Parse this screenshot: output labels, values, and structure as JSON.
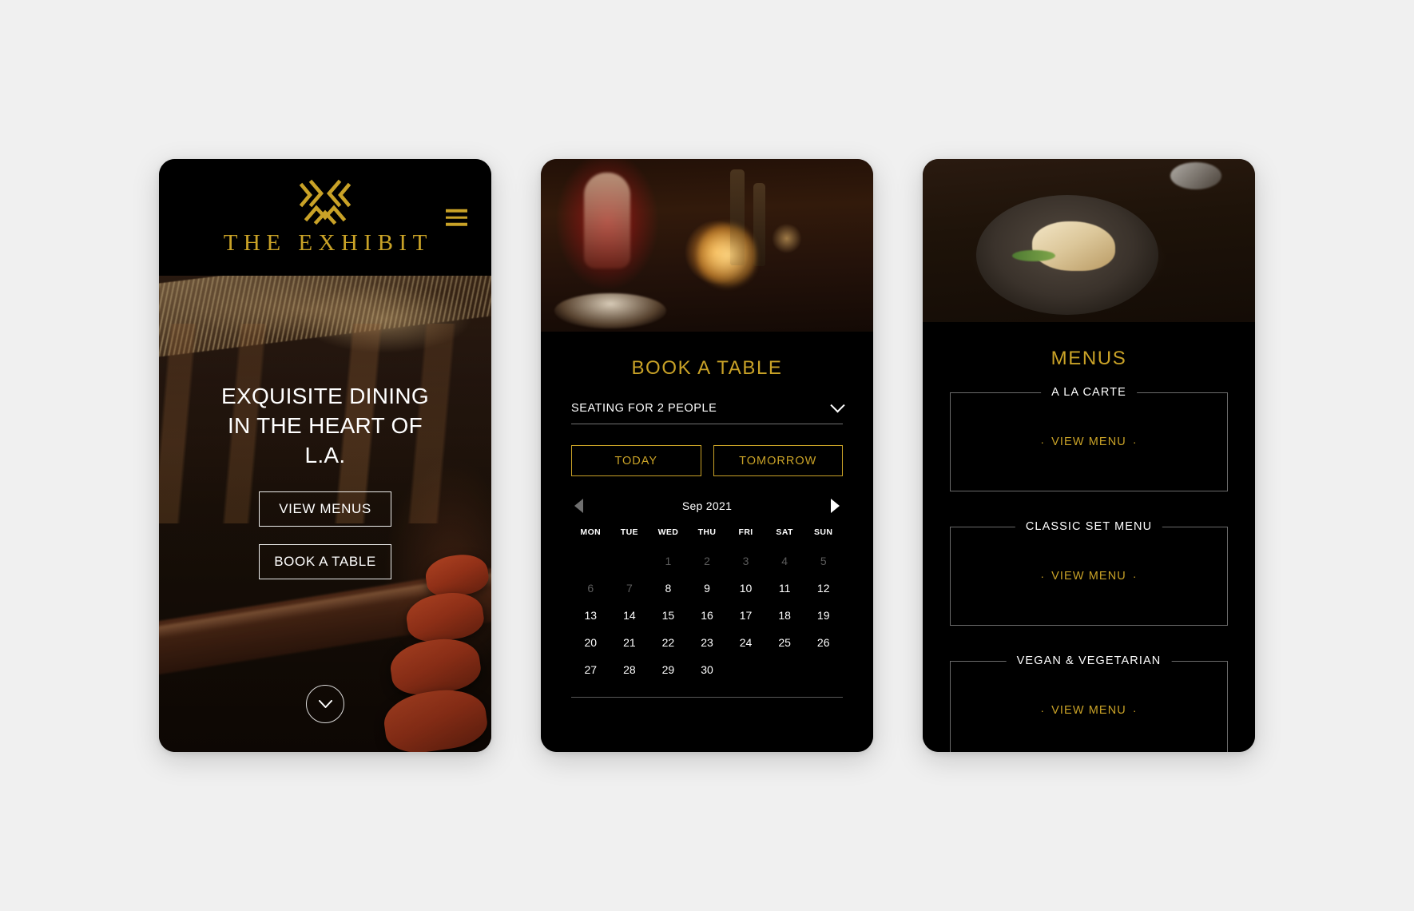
{
  "brand": {
    "name": "THE EXHIBIT",
    "logo_icon": "x-monogram-logo",
    "gold": "#c9a227"
  },
  "phone1": {
    "menu_icon": "hamburger-menu-icon",
    "hero_title": "EXQUISITE DINING IN THE HEART OF L.A.",
    "buttons": [
      {
        "label": "VIEW MENUS"
      },
      {
        "label": "BOOK A TABLE"
      }
    ],
    "scroll_icon": "chevron-down-icon"
  },
  "phone2": {
    "title": "BOOK A TABLE",
    "seating": {
      "value": "SEATING FOR 2 PEOPLE",
      "caret_icon": "chevron-down-icon"
    },
    "quick_days": [
      {
        "label": "TODAY"
      },
      {
        "label": "TOMORROW"
      }
    ],
    "calendar": {
      "month": "Sep 2021",
      "prev_icon": "arrow-left-icon",
      "next_icon": "arrow-right-icon",
      "weekdays": [
        "MON",
        "TUE",
        "WED",
        "THU",
        "FRI",
        "SAT",
        "SUN"
      ],
      "leading_blanks": 2,
      "days": [
        {
          "n": "1",
          "muted": true
        },
        {
          "n": "2",
          "muted": true
        },
        {
          "n": "3",
          "muted": true
        },
        {
          "n": "4",
          "muted": true
        },
        {
          "n": "5",
          "muted": true
        },
        {
          "n": "6",
          "muted": true
        },
        {
          "n": "7",
          "muted": true
        },
        {
          "n": "8",
          "muted": false
        },
        {
          "n": "9",
          "muted": false
        },
        {
          "n": "10",
          "muted": false
        },
        {
          "n": "11",
          "muted": false
        },
        {
          "n": "12",
          "muted": false
        },
        {
          "n": "13",
          "muted": false
        },
        {
          "n": "14",
          "muted": false
        },
        {
          "n": "15",
          "muted": false
        },
        {
          "n": "16",
          "muted": false
        },
        {
          "n": "17",
          "muted": false
        },
        {
          "n": "18",
          "muted": false
        },
        {
          "n": "19",
          "muted": false
        },
        {
          "n": "20",
          "muted": false
        },
        {
          "n": "21",
          "muted": false
        },
        {
          "n": "22",
          "muted": false
        },
        {
          "n": "23",
          "muted": false
        },
        {
          "n": "24",
          "muted": false
        },
        {
          "n": "25",
          "muted": false
        },
        {
          "n": "26",
          "muted": false
        },
        {
          "n": "27",
          "muted": false
        },
        {
          "n": "28",
          "muted": false
        },
        {
          "n": "29",
          "muted": false
        },
        {
          "n": "30",
          "muted": false
        }
      ]
    }
  },
  "phone3": {
    "title": "MENUS",
    "cards": [
      {
        "title": "A LA CARTE",
        "link": "VIEW MENU"
      },
      {
        "title": "CLASSIC SET MENU",
        "link": "VIEW MENU"
      },
      {
        "title": "VEGAN & VEGETARIAN",
        "link": "VIEW MENU"
      }
    ],
    "link_dot": "·"
  }
}
